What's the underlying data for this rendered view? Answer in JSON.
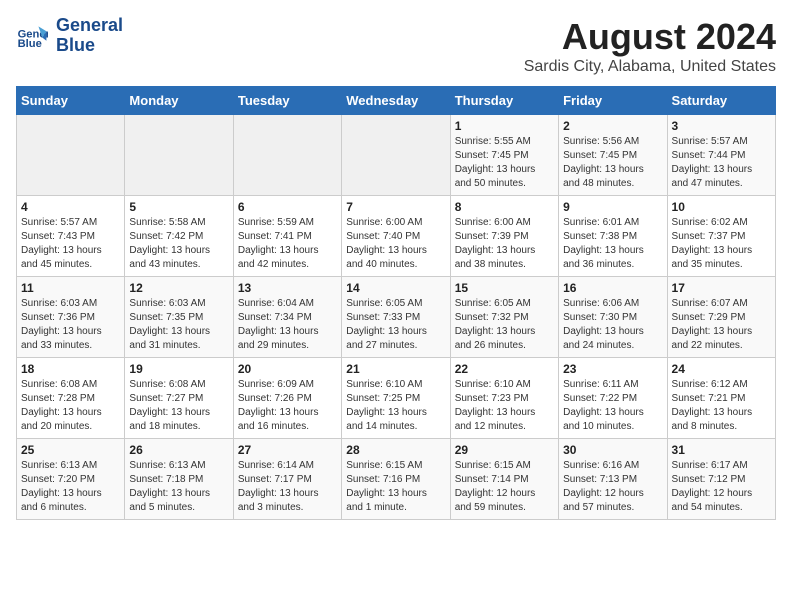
{
  "header": {
    "logo_line1": "General",
    "logo_line2": "Blue",
    "title": "August 2024",
    "subtitle": "Sardis City, Alabama, United States"
  },
  "days_of_week": [
    "Sunday",
    "Monday",
    "Tuesday",
    "Wednesday",
    "Thursday",
    "Friday",
    "Saturday"
  ],
  "weeks": [
    [
      {
        "day": "",
        "info": ""
      },
      {
        "day": "",
        "info": ""
      },
      {
        "day": "",
        "info": ""
      },
      {
        "day": "",
        "info": ""
      },
      {
        "day": "1",
        "info": "Sunrise: 5:55 AM\nSunset: 7:45 PM\nDaylight: 13 hours\nand 50 minutes."
      },
      {
        "day": "2",
        "info": "Sunrise: 5:56 AM\nSunset: 7:45 PM\nDaylight: 13 hours\nand 48 minutes."
      },
      {
        "day": "3",
        "info": "Sunrise: 5:57 AM\nSunset: 7:44 PM\nDaylight: 13 hours\nand 47 minutes."
      }
    ],
    [
      {
        "day": "4",
        "info": "Sunrise: 5:57 AM\nSunset: 7:43 PM\nDaylight: 13 hours\nand 45 minutes."
      },
      {
        "day": "5",
        "info": "Sunrise: 5:58 AM\nSunset: 7:42 PM\nDaylight: 13 hours\nand 43 minutes."
      },
      {
        "day": "6",
        "info": "Sunrise: 5:59 AM\nSunset: 7:41 PM\nDaylight: 13 hours\nand 42 minutes."
      },
      {
        "day": "7",
        "info": "Sunrise: 6:00 AM\nSunset: 7:40 PM\nDaylight: 13 hours\nand 40 minutes."
      },
      {
        "day": "8",
        "info": "Sunrise: 6:00 AM\nSunset: 7:39 PM\nDaylight: 13 hours\nand 38 minutes."
      },
      {
        "day": "9",
        "info": "Sunrise: 6:01 AM\nSunset: 7:38 PM\nDaylight: 13 hours\nand 36 minutes."
      },
      {
        "day": "10",
        "info": "Sunrise: 6:02 AM\nSunset: 7:37 PM\nDaylight: 13 hours\nand 35 minutes."
      }
    ],
    [
      {
        "day": "11",
        "info": "Sunrise: 6:03 AM\nSunset: 7:36 PM\nDaylight: 13 hours\nand 33 minutes."
      },
      {
        "day": "12",
        "info": "Sunrise: 6:03 AM\nSunset: 7:35 PM\nDaylight: 13 hours\nand 31 minutes."
      },
      {
        "day": "13",
        "info": "Sunrise: 6:04 AM\nSunset: 7:34 PM\nDaylight: 13 hours\nand 29 minutes."
      },
      {
        "day": "14",
        "info": "Sunrise: 6:05 AM\nSunset: 7:33 PM\nDaylight: 13 hours\nand 27 minutes."
      },
      {
        "day": "15",
        "info": "Sunrise: 6:05 AM\nSunset: 7:32 PM\nDaylight: 13 hours\nand 26 minutes."
      },
      {
        "day": "16",
        "info": "Sunrise: 6:06 AM\nSunset: 7:30 PM\nDaylight: 13 hours\nand 24 minutes."
      },
      {
        "day": "17",
        "info": "Sunrise: 6:07 AM\nSunset: 7:29 PM\nDaylight: 13 hours\nand 22 minutes."
      }
    ],
    [
      {
        "day": "18",
        "info": "Sunrise: 6:08 AM\nSunset: 7:28 PM\nDaylight: 13 hours\nand 20 minutes."
      },
      {
        "day": "19",
        "info": "Sunrise: 6:08 AM\nSunset: 7:27 PM\nDaylight: 13 hours\nand 18 minutes."
      },
      {
        "day": "20",
        "info": "Sunrise: 6:09 AM\nSunset: 7:26 PM\nDaylight: 13 hours\nand 16 minutes."
      },
      {
        "day": "21",
        "info": "Sunrise: 6:10 AM\nSunset: 7:25 PM\nDaylight: 13 hours\nand 14 minutes."
      },
      {
        "day": "22",
        "info": "Sunrise: 6:10 AM\nSunset: 7:23 PM\nDaylight: 13 hours\nand 12 minutes."
      },
      {
        "day": "23",
        "info": "Sunrise: 6:11 AM\nSunset: 7:22 PM\nDaylight: 13 hours\nand 10 minutes."
      },
      {
        "day": "24",
        "info": "Sunrise: 6:12 AM\nSunset: 7:21 PM\nDaylight: 13 hours\nand 8 minutes."
      }
    ],
    [
      {
        "day": "25",
        "info": "Sunrise: 6:13 AM\nSunset: 7:20 PM\nDaylight: 13 hours\nand 6 minutes."
      },
      {
        "day": "26",
        "info": "Sunrise: 6:13 AM\nSunset: 7:18 PM\nDaylight: 13 hours\nand 5 minutes."
      },
      {
        "day": "27",
        "info": "Sunrise: 6:14 AM\nSunset: 7:17 PM\nDaylight: 13 hours\nand 3 minutes."
      },
      {
        "day": "28",
        "info": "Sunrise: 6:15 AM\nSunset: 7:16 PM\nDaylight: 13 hours\nand 1 minute."
      },
      {
        "day": "29",
        "info": "Sunrise: 6:15 AM\nSunset: 7:14 PM\nDaylight: 12 hours\nand 59 minutes."
      },
      {
        "day": "30",
        "info": "Sunrise: 6:16 AM\nSunset: 7:13 PM\nDaylight: 12 hours\nand 57 minutes."
      },
      {
        "day": "31",
        "info": "Sunrise: 6:17 AM\nSunset: 7:12 PM\nDaylight: 12 hours\nand 54 minutes."
      }
    ]
  ]
}
